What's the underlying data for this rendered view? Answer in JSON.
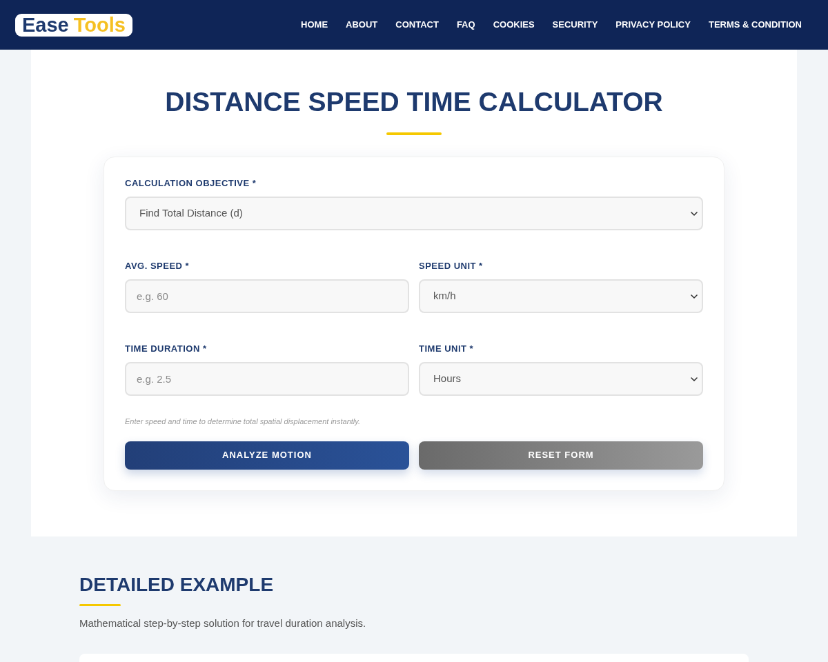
{
  "header": {
    "logo": [
      {
        "text": "Ease",
        "kind": "primary"
      },
      {
        "text": "Tools",
        "kind": "accent"
      }
    ],
    "nav": [
      {
        "label": "HOME"
      },
      {
        "label": "ABOUT"
      },
      {
        "label": "CONTACT"
      },
      {
        "label": "FAQ"
      },
      {
        "label": "COOKIES"
      },
      {
        "label": "SECURITY"
      },
      {
        "label": "PRIVACY POLICY"
      },
      {
        "label": "TERMS & CONDITION"
      }
    ]
  },
  "calculator": {
    "title": "DISTANCE SPEED TIME CALCULATOR",
    "rows": [
      {
        "fields": [
          {
            "kind": "select",
            "label": "CALCULATION OBJECTIVE *",
            "value": "Find Total Distance (d)"
          }
        ]
      },
      {
        "fields": [
          {
            "kind": "input",
            "label": "AVG. SPEED *",
            "placeholder": "e.g. 60"
          },
          {
            "kind": "select",
            "label": "SPEED UNIT *",
            "value": "km/h"
          }
        ]
      },
      {
        "fields": [
          {
            "kind": "input",
            "label": "TIME DURATION *",
            "placeholder": "e.g. 2.5"
          },
          {
            "kind": "select",
            "label": "TIME UNIT *",
            "value": "Hours"
          }
        ]
      }
    ],
    "hint": "Enter speed and time to determine total spatial displacement instantly.",
    "buttons": [
      {
        "label": "ANALYZE MOTION",
        "kind": "primary"
      },
      {
        "label": "RESET FORM",
        "kind": "secondary"
      }
    ]
  },
  "example": {
    "title": "DETAILED EXAMPLE",
    "description": "Mathematical step-by-step solution for travel duration analysis."
  }
}
